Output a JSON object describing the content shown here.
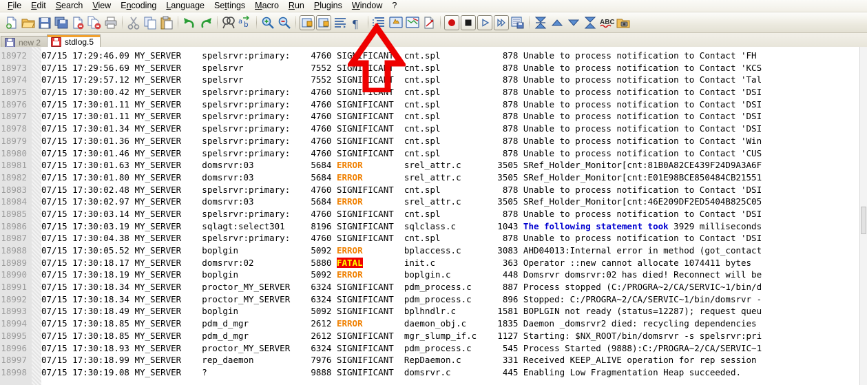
{
  "app": {
    "name": "Notepad++"
  },
  "menubar": {
    "items": [
      {
        "label": "File",
        "mnemonic": "F"
      },
      {
        "label": "Edit",
        "mnemonic": "E"
      },
      {
        "label": "Search",
        "mnemonic": "S"
      },
      {
        "label": "View",
        "mnemonic": "V"
      },
      {
        "label": "Encoding",
        "mnemonic": "n"
      },
      {
        "label": "Language",
        "mnemonic": "L"
      },
      {
        "label": "Settings",
        "mnemonic": "t"
      },
      {
        "label": "Macro",
        "mnemonic": "M"
      },
      {
        "label": "Run",
        "mnemonic": "R"
      },
      {
        "label": "Plugins",
        "mnemonic": "P"
      },
      {
        "label": "Window",
        "mnemonic": "W"
      },
      {
        "label": "?",
        "mnemonic": "?"
      }
    ]
  },
  "toolbar": {
    "icons": [
      "new-file-icon",
      "open-file-icon",
      "save-icon",
      "save-all-icon",
      "close-file-icon",
      "close-all-icon",
      "print-icon",
      "cut-icon",
      "copy-icon",
      "paste-icon",
      "undo-icon",
      "redo-icon",
      "find-icon",
      "replace-icon",
      "zoom-in-icon",
      "zoom-out-icon",
      "sync-vertical-scroll-icon",
      "sync-horizontal-scroll-icon",
      "word-wrap-icon",
      "show-all-characters-icon",
      "indent-guideline-icon",
      "show-ui-panel-icon",
      "user-defined-language-icon",
      "document-map-icon",
      "start-record-macro-icon",
      "stop-record-macro-icon",
      "play-macro-icon",
      "run-macro-multiple-icon",
      "save-macro-icon",
      "collapse-all-icon",
      "collapse-current-level-icon",
      "expand-current-level-icon",
      "expand-all-icon",
      "spell-check-icon",
      "run-program-icon"
    ]
  },
  "tabs": [
    {
      "label": "new  2",
      "active": false,
      "icon": "floppy-blue-icon"
    },
    {
      "label": "stdlog.5",
      "active": true,
      "icon": "floppy-red-icon"
    }
  ],
  "annotation": {
    "type": "red-up-arrow",
    "color": "#ee0000"
  },
  "editor": {
    "first_line": 18972,
    "lines": [
      {
        "n": "18972",
        "a": "07/15 17:29:46.09 MY_SERVER",
        "proc": "spelsrvr:primary:",
        "pid": "4760",
        "sev": "SIGNIFICANT",
        "sev_type": "plain",
        "src": "cnt.spl",
        "code": "878",
        "msg": "Unable to process notification to Contact 'FH",
        "msg_type": "plain"
      },
      {
        "n": "18973",
        "a": "07/15 17:29:56.69 MY_SERVER",
        "proc": "spelsrvr",
        "pid": "7552",
        "sev": "SIGNIFICANT",
        "sev_type": "plain",
        "src": "cnt.spl",
        "code": "878",
        "msg": "Unable to process notification to Contact 'KCS",
        "msg_type": "plain"
      },
      {
        "n": "18974",
        "a": "07/15 17:29:57.12 MY_SERVER",
        "proc": "spelsrvr",
        "pid": "7552",
        "sev": "SIGNIFICANT",
        "sev_type": "plain",
        "src": "cnt.spl",
        "code": "878",
        "msg": "Unable to process notification to Contact 'Tal",
        "msg_type": "plain"
      },
      {
        "n": "18975",
        "a": "07/15 17:30:00.42 MY_SERVER",
        "proc": "spelsrvr:primary:",
        "pid": "4760",
        "sev": "SIGNIFICANT",
        "sev_type": "plain",
        "src": "cnt.spl",
        "code": "878",
        "msg": "Unable to process notification to Contact 'DSI",
        "msg_type": "plain"
      },
      {
        "n": "18976",
        "a": "07/15 17:30:01.11 MY_SERVER",
        "proc": "spelsrvr:primary:",
        "pid": "4760",
        "sev": "SIGNIFICANT",
        "sev_type": "plain",
        "src": "cnt.spl",
        "code": "878",
        "msg": "Unable to process notification to Contact 'DSI",
        "msg_type": "plain"
      },
      {
        "n": "18977",
        "a": "07/15 17:30:01.11 MY_SERVER",
        "proc": "spelsrvr:primary:",
        "pid": "4760",
        "sev": "SIGNIFICANT",
        "sev_type": "plain",
        "src": "cnt.spl",
        "code": "878",
        "msg": "Unable to process notification to Contact 'DSI",
        "msg_type": "plain"
      },
      {
        "n": "18978",
        "a": "07/15 17:30:01.34 MY_SERVER",
        "proc": "spelsrvr:primary:",
        "pid": "4760",
        "sev": "SIGNIFICANT",
        "sev_type": "plain",
        "src": "cnt.spl",
        "code": "878",
        "msg": "Unable to process notification to Contact 'DSI",
        "msg_type": "plain"
      },
      {
        "n": "18979",
        "a": "07/15 17:30:01.36 MY_SERVER",
        "proc": "spelsrvr:primary:",
        "pid": "4760",
        "sev": "SIGNIFICANT",
        "sev_type": "plain",
        "src": "cnt.spl",
        "code": "878",
        "msg": "Unable to process notification to Contact 'Win",
        "msg_type": "plain"
      },
      {
        "n": "18980",
        "a": "07/15 17:30:01.46 MY_SERVER",
        "proc": "spelsrvr:primary:",
        "pid": "4760",
        "sev": "SIGNIFICANT",
        "sev_type": "plain",
        "src": "cnt.spl",
        "code": "878",
        "msg": "Unable to process notification to Contact 'CUS",
        "msg_type": "plain"
      },
      {
        "n": "18981",
        "a": "07/15 17:30:01.63 MY_SERVER",
        "proc": "domsrvr:03",
        "pid": "5684",
        "sev": "ERROR",
        "sev_type": "error",
        "src": "srel_attr.c",
        "code": "3505",
        "msg": "SRef_Holder_Monitor[cnt:81B0A82CE439F24D9A3A6F",
        "msg_type": "plain"
      },
      {
        "n": "18982",
        "a": "07/15 17:30:01.80 MY_SERVER",
        "proc": "domsrvr:03",
        "pid": "5684",
        "sev": "ERROR",
        "sev_type": "error",
        "src": "srel_attr.c",
        "code": "3505",
        "msg": "SRef_Holder_Monitor[cnt:E01E98BCE850484CB21551",
        "msg_type": "plain"
      },
      {
        "n": "18983",
        "a": "07/15 17:30:02.48 MY_SERVER",
        "proc": "spelsrvr:primary:",
        "pid": "4760",
        "sev": "SIGNIFICANT",
        "sev_type": "plain",
        "src": "cnt.spl",
        "code": "878",
        "msg": "Unable to process notification to Contact 'DSI",
        "msg_type": "plain"
      },
      {
        "n": "18984",
        "a": "07/15 17:30:02.97 MY_SERVER",
        "proc": "domsrvr:03",
        "pid": "5684",
        "sev": "ERROR",
        "sev_type": "error",
        "src": "srel_attr.c",
        "code": "3505",
        "msg": "SRef_Holder_Monitor[cnt:46E209DF2ED5404B825C05",
        "msg_type": "plain"
      },
      {
        "n": "18985",
        "a": "07/15 17:30:03.14 MY_SERVER",
        "proc": "spelsrvr:primary:",
        "pid": "4760",
        "sev": "SIGNIFICANT",
        "sev_type": "plain",
        "src": "cnt.spl",
        "code": "878",
        "msg": "Unable to process notification to Contact 'DSI",
        "msg_type": "plain"
      },
      {
        "n": "18986",
        "a": "07/15 17:30:03.19 MY_SERVER",
        "proc": "sqlagt:select301",
        "pid": "8196",
        "sev": "SIGNIFICANT",
        "sev_type": "plain",
        "src": "sqlclass.c",
        "code": "1043",
        "msg": "The following statement took",
        "msg2": " 3929 milliseconds",
        "msg_type": "blue"
      },
      {
        "n": "18987",
        "a": "07/15 17:30:04.38 MY_SERVER",
        "proc": "spelsrvr:primary:",
        "pid": "4760",
        "sev": "SIGNIFICANT",
        "sev_type": "plain",
        "src": "cnt.spl",
        "code": "878",
        "msg": "Unable to process notification to Contact 'DSI",
        "msg_type": "plain"
      },
      {
        "n": "18988",
        "a": "07/15 17:30:05.52 MY_SERVER",
        "proc": "boplgin",
        "pid": "5092",
        "sev": "ERROR",
        "sev_type": "error",
        "src": "bplaccess.c",
        "code": "3083",
        "msg": "AHD04013:Internal error in method (got_contact",
        "msg_type": "plain"
      },
      {
        "n": "18989",
        "a": "07/15 17:30:18.17 MY_SERVER",
        "proc": "domsrvr:02",
        "pid": "5880",
        "sev": "FATAL",
        "sev_type": "fatal",
        "src": "init.c",
        "code": "363",
        "msg": "Operator ::new cannot allocate 1074411 bytes",
        "msg_type": "plain"
      },
      {
        "n": "18990",
        "a": "07/15 17:30:18.19 MY_SERVER",
        "proc": "boplgin",
        "pid": "5092",
        "sev": "ERROR",
        "sev_type": "error",
        "src": "boplgin.c",
        "code": "448",
        "msg": "Domsrvr domsrvr:02 has died! Reconnect will be",
        "msg_type": "plain"
      },
      {
        "n": "18991",
        "a": "07/15 17:30:18.34 MY_SERVER",
        "proc": "proctor_MY_SERVER",
        "pid": "6324",
        "sev": "SIGNIFICANT",
        "sev_type": "plain",
        "src": "pdm_process.c",
        "code": "887",
        "msg": "Process stopped (C:/PROGRA~2/CA/SERVIC~1/bin/d",
        "msg_type": "plain"
      },
      {
        "n": "18992",
        "a": "07/15 17:30:18.34 MY_SERVER",
        "proc": "proctor_MY_SERVER",
        "pid": "6324",
        "sev": "SIGNIFICANT",
        "sev_type": "plain",
        "src": "pdm_process.c",
        "code": "896",
        "msg": "Stopped: C:/PROGRA~2/CA/SERVIC~1/bin/domsrvr -",
        "msg_type": "plain"
      },
      {
        "n": "18993",
        "a": "07/15 17:30:18.49 MY_SERVER",
        "proc": "boplgin",
        "pid": "5092",
        "sev": "SIGNIFICANT",
        "sev_type": "plain",
        "src": "bplhndlr.c",
        "code": "1581",
        "msg": "BOPLGIN not ready (status=12287); request queu",
        "msg_type": "plain"
      },
      {
        "n": "18994",
        "a": "07/15 17:30:18.85 MY_SERVER",
        "proc": "pdm_d_mgr",
        "pid": "2612",
        "sev": "ERROR",
        "sev_type": "error",
        "src": "daemon_obj.c",
        "code": "1835",
        "msg": "Daemon _domsrvr2 died: recycling dependencies",
        "msg_type": "plain"
      },
      {
        "n": "18995",
        "a": "07/15 17:30:18.85 MY_SERVER",
        "proc": "pdm_d_mgr",
        "pid": "2612",
        "sev": "SIGNIFICANT",
        "sev_type": "plain",
        "src": "mgr_slump_if.c",
        "code": "1127",
        "msg": "Starting: $NX_ROOT/bin/domsrvr -s spelsrvr:pri",
        "msg_type": "plain"
      },
      {
        "n": "18996",
        "a": "07/15 17:30:18.93 MY_SERVER",
        "proc": "proctor_MY_SERVER",
        "pid": "6324",
        "sev": "SIGNIFICANT",
        "sev_type": "plain",
        "src": "pdm_process.c",
        "code": "545",
        "msg": "Process Started (9888):C:/PROGRA~2/CA/SERVIC~1",
        "msg_type": "plain"
      },
      {
        "n": "18997",
        "a": "07/15 17:30:18.99 MY_SERVER",
        "proc": "rep_daemon",
        "pid": "7976",
        "sev": "SIGNIFICANT",
        "sev_type": "plain",
        "src": "RepDaemon.c",
        "code": "331",
        "msg": "Received KEEP_ALIVE operation for rep session",
        "msg_type": "plain"
      },
      {
        "n": "18998",
        "a": "07/15 17:30:19.08 MY_SERVER",
        "proc": "?",
        "pid": "9888",
        "sev": "SIGNIFICANT",
        "sev_type": "plain",
        "src": "domsrvr.c",
        "code": "445",
        "msg": "Enabling Low Fragmentation Heap succeeded.",
        "msg_type": "plain"
      }
    ]
  },
  "colors": {
    "error": "#f08000",
    "fatal_fg": "#ffff00",
    "fatal_bg": "#ee0000",
    "highlight_blue": "#0000d0",
    "annotation_red": "#ee0000",
    "tab_active_accent": "#f0a030"
  }
}
